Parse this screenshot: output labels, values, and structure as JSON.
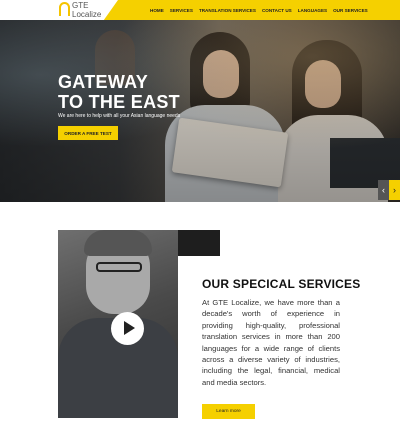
{
  "logo": {
    "line1": "GTE",
    "line2": "Localize"
  },
  "nav": [
    "HOME",
    "SERVICES",
    "TRANSLATION SERVICES",
    "CONTACT US",
    "LANGUAGES",
    "OUR SERVICES"
  ],
  "hero": {
    "title_line1": "GATEWAY",
    "title_line2": "TO THE EAST",
    "subtitle": "We are here to help with all your Asian language needs",
    "cta": "ORDER A FREE TEST",
    "prev": "‹",
    "next": "›"
  },
  "services": {
    "title": "OUR SPECICAL SERVICES",
    "body": "At GTE Localize, we have more than a decade's worth of experience in providing high-quality, professional translation services in more than 200 languages for a wide range of clients across a diverse variety of industries, including the legal, financial, medical and media sectors.",
    "button": "Learn more"
  },
  "colors": {
    "accent": "#f5d000"
  },
  "icons": {
    "play": "play-icon",
    "logo": "logo-icon",
    "prev": "chevron-left-icon",
    "next": "chevron-right-icon"
  }
}
